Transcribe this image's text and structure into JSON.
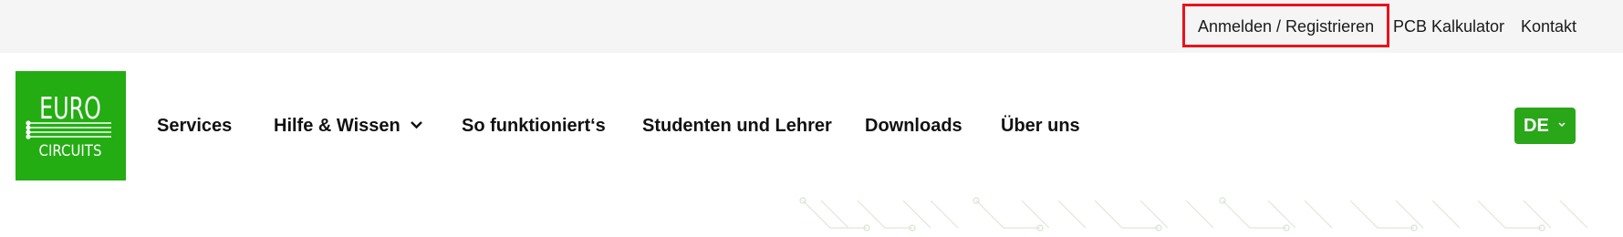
{
  "topbar": {
    "links": [
      {
        "label": "Anmelden / Registrieren",
        "highlighted": true
      },
      {
        "label": "PCB Kalkulator"
      },
      {
        "label": "Kontakt"
      }
    ]
  },
  "logo": {
    "line1": "EURO",
    "line2": "CIRCUITS",
    "bg_color": "#23ad13"
  },
  "nav": {
    "items": [
      {
        "label": "Services"
      },
      {
        "label": "Hilfe & Wissen",
        "icon": "chevron-down-icon"
      },
      {
        "label": "So funktioniert‘s"
      },
      {
        "label": "Studenten und Lehrer"
      },
      {
        "label": "Downloads"
      },
      {
        "label": "Über uns"
      }
    ]
  },
  "language": {
    "selected": "DE",
    "icon": "chevron-down-icon",
    "bg_color": "#2aa619"
  },
  "colors": {
    "topbar_bg": "#f5f5f5",
    "highlight_border": "#e8141c",
    "brand_green": "#23ad13"
  }
}
